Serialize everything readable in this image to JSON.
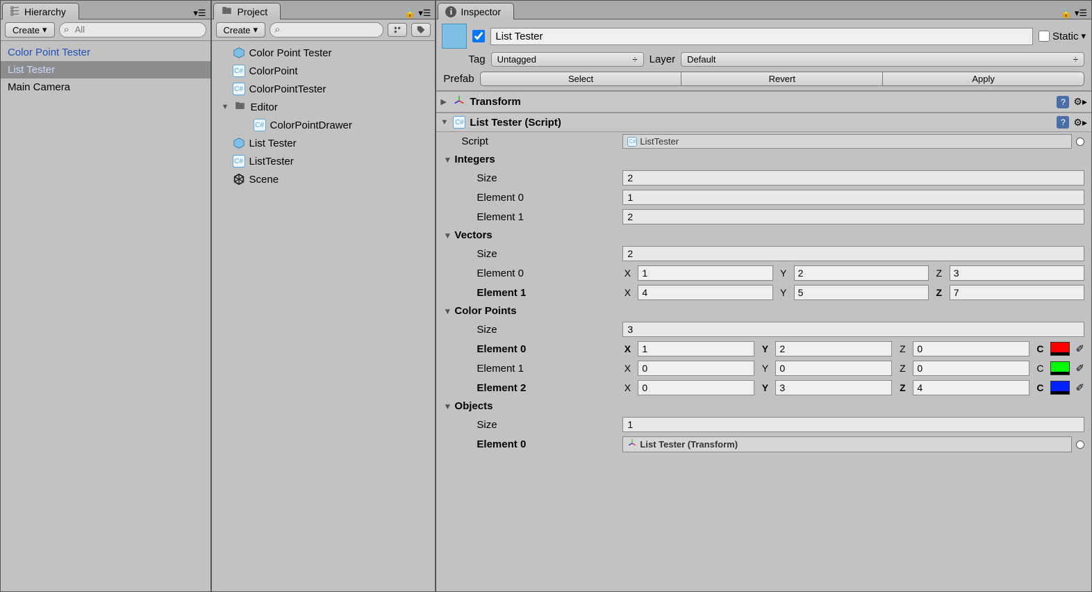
{
  "hierarchy": {
    "tab_title": "Hierarchy",
    "create_label": "Create",
    "search_placeholder": "All",
    "items": [
      {
        "label": "Color Point Tester",
        "style": "blue"
      },
      {
        "label": "List Tester",
        "style": "selected"
      },
      {
        "label": "Main Camera",
        "style": ""
      }
    ]
  },
  "project": {
    "tab_title": "Project",
    "create_label": "Create",
    "items": [
      {
        "icon": "prefab",
        "label": "Color Point Tester",
        "indent": 1
      },
      {
        "icon": "cs",
        "label": "ColorPoint",
        "indent": 1
      },
      {
        "icon": "cs",
        "label": "ColorPointTester",
        "indent": 1
      },
      {
        "icon": "folder",
        "label": "Editor",
        "indent": 1,
        "fold": "▼"
      },
      {
        "icon": "cs",
        "label": "ColorPointDrawer",
        "indent": 2
      },
      {
        "icon": "prefab",
        "label": "List Tester",
        "indent": 1
      },
      {
        "icon": "cs",
        "label": "ListTester",
        "indent": 1
      },
      {
        "icon": "unity",
        "label": "Scene",
        "indent": 1
      }
    ]
  },
  "inspector": {
    "tab_title": "Inspector",
    "name": "List Tester",
    "static_label": "Static",
    "tag_label": "Tag",
    "tag_value": "Untagged",
    "layer_label": "Layer",
    "layer_value": "Default",
    "prefab_label": "Prefab",
    "prefab_buttons": [
      "Select",
      "Revert",
      "Apply"
    ],
    "transform_title": "Transform",
    "script_component_title": "List Tester (Script)",
    "script_label": "Script",
    "script_value": "ListTester",
    "integers": {
      "title": "Integers",
      "size_label": "Size",
      "size": "2",
      "rows": [
        {
          "label": "Element 0",
          "value": "1"
        },
        {
          "label": "Element 1",
          "value": "2"
        }
      ]
    },
    "vectors": {
      "title": "Vectors",
      "size_label": "Size",
      "size": "2",
      "rows": [
        {
          "label": "Element 0",
          "bold": false,
          "x": "1",
          "y": "2",
          "z": "3",
          "zbold": false,
          "xbold": false,
          "ybold": false
        },
        {
          "label": "Element 1",
          "bold": true,
          "x": "4",
          "y": "5",
          "z": "7",
          "zbold": true,
          "xbold": false,
          "ybold": false
        }
      ]
    },
    "colorpoints": {
      "title": "Color Points",
      "size_label": "Size",
      "size": "3",
      "rows": [
        {
          "label": "Element 0",
          "bold": true,
          "x": "1",
          "xbold": true,
          "y": "2",
          "ybold": true,
          "z": "0",
          "zbold": false,
          "c": "#ff0000",
          "cbold": true
        },
        {
          "label": "Element 1",
          "bold": false,
          "x": "0",
          "xbold": false,
          "y": "0",
          "ybold": false,
          "z": "0",
          "zbold": false,
          "c": "#00ff00",
          "cbold": false
        },
        {
          "label": "Element 2",
          "bold": true,
          "x": "0",
          "xbold": false,
          "y": "3",
          "ybold": true,
          "z": "4",
          "zbold": true,
          "c": "#0020ff",
          "cbold": true
        }
      ]
    },
    "objects": {
      "title": "Objects",
      "size_label": "Size",
      "size": "1",
      "rows": [
        {
          "label": "Element 0",
          "bold": true,
          "value": "List Tester (Transform)"
        }
      ]
    }
  }
}
